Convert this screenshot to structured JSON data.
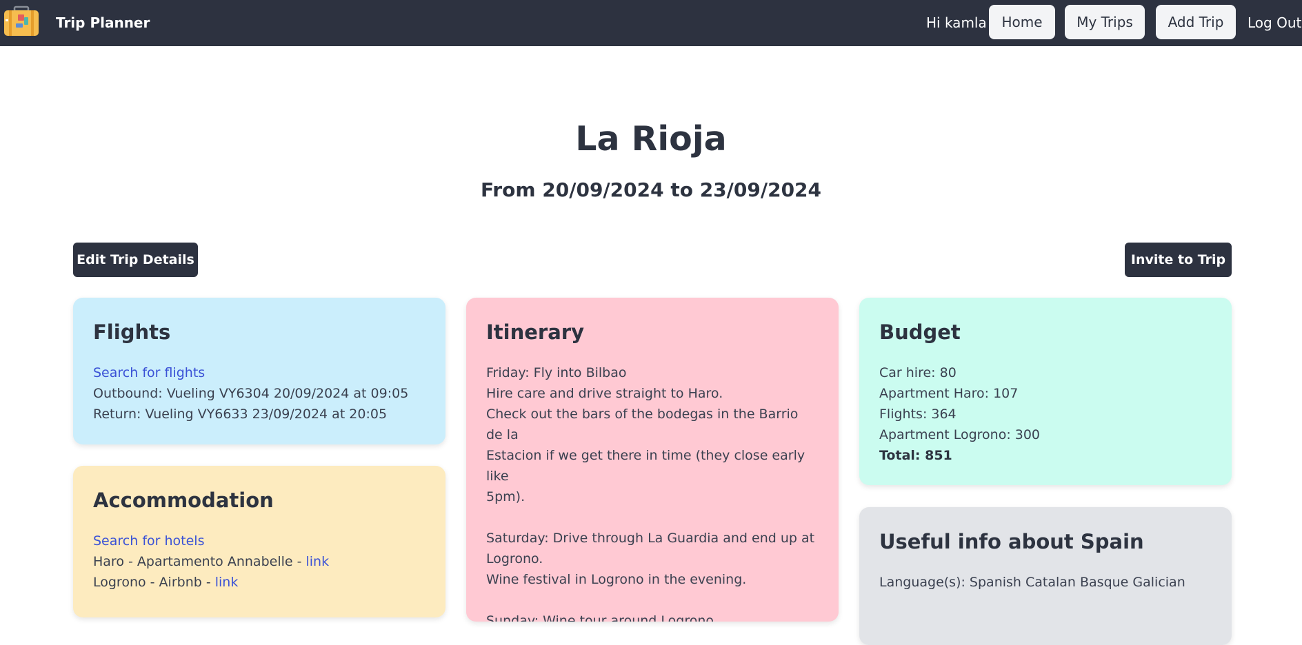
{
  "nav": {
    "brand": "Trip Planner",
    "greeting": "Hi kamla",
    "home": "Home",
    "my_trips": "My Trips",
    "add_trip": "Add Trip",
    "log_out": "Log Out"
  },
  "trip": {
    "title": "La Rioja",
    "dates": "From 20/09/2024 to 23/09/2024"
  },
  "actions": {
    "edit": "Edit Trip Details",
    "invite": "Invite to Trip"
  },
  "flights": {
    "heading": "Flights",
    "search_link": "Search for flights",
    "outbound": "Outbound: Vueling VY6304 20/09/2024 at 09:05",
    "return": "Return: Vueling VY6633 23/09/2024 at 20:05"
  },
  "accommodation": {
    "heading": "Accommodation",
    "search_link": "Search for hotels",
    "items": [
      {
        "text": "Haro - Apartamento Annabelle - ",
        "link": "link"
      },
      {
        "text": "Logrono - Airbnb - ",
        "link": "link"
      }
    ]
  },
  "itinerary": {
    "heading": "Itinerary",
    "lines": [
      "Friday: Fly into Bilbao",
      "Hire care and drive straight to Haro.",
      "Check out the bars of the bodegas in the Barrio de la",
      "Estacion if we get there in time (they close early like",
      "5pm).",
      "",
      "Saturday: Drive through La Guardia and end up at",
      "Logrono.",
      "Wine festival in Logrono in the evening.",
      "",
      "Sunday: Wine tour around Logrono."
    ]
  },
  "budget": {
    "heading": "Budget",
    "items": [
      "Car hire: 80",
      "Apartment Haro: 107",
      "Flights: 364",
      "Apartment Logrono: 300"
    ],
    "total": "Total: 851"
  },
  "info": {
    "heading": "Useful info about Spain",
    "languages": "Language(s): Spanish Catalan Basque Galician"
  },
  "colors": {
    "navbar": "#2d3240",
    "flights_card": "#cbeefc",
    "accommodation_card": "#fdebbf",
    "itinerary_card": "#ffc9d3",
    "budget_card": "#cbfcf0",
    "info_card": "#e2e4e8",
    "link": "#3b52d6"
  },
  "icons": {
    "logo": "suitcase-icon"
  }
}
